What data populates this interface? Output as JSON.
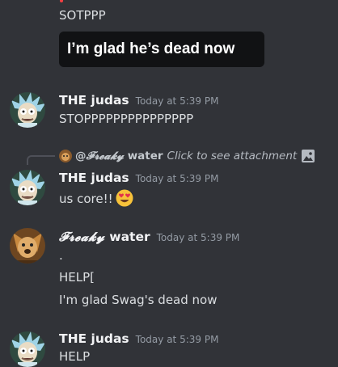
{
  "messages": [
    {
      "lines": [
        "SOTPPP"
      ],
      "embed_text": "I’m glad he’s dead now"
    },
    {
      "author": "THE judas",
      "timestamp": "Today at 5:39 PM",
      "lines": [
        "STOPPPPPPPPPPPPPPP"
      ]
    },
    {
      "reply": {
        "mention": "@",
        "name_fancy": "𝓕𝓻𝓮𝓪𝓴𝔂",
        "name_plain": "water",
        "text": "Click to see attachment",
        "icon": "image-icon"
      },
      "author": "THE judas",
      "timestamp": "Today at 5:39 PM",
      "lines": [
        "us core!!"
      ],
      "emoji": "heart-eyes-emoji"
    },
    {
      "author_fancy": "𝓕𝓻𝓮𝓪𝓴𝔂",
      "author_plain": "water",
      "timestamp": "Today at 5:39 PM",
      "lines": [
        ".",
        "HELP[",
        "I'm glad Swag's dead now"
      ]
    },
    {
      "author": "THE judas",
      "timestamp": "Today at 5:39 PM",
      "lines": [
        "HELP"
      ]
    }
  ],
  "colors": {
    "background": "#313338",
    "text": "#dbdee1",
    "timestamp": "#949ba4",
    "embed_bg": "#111214"
  }
}
